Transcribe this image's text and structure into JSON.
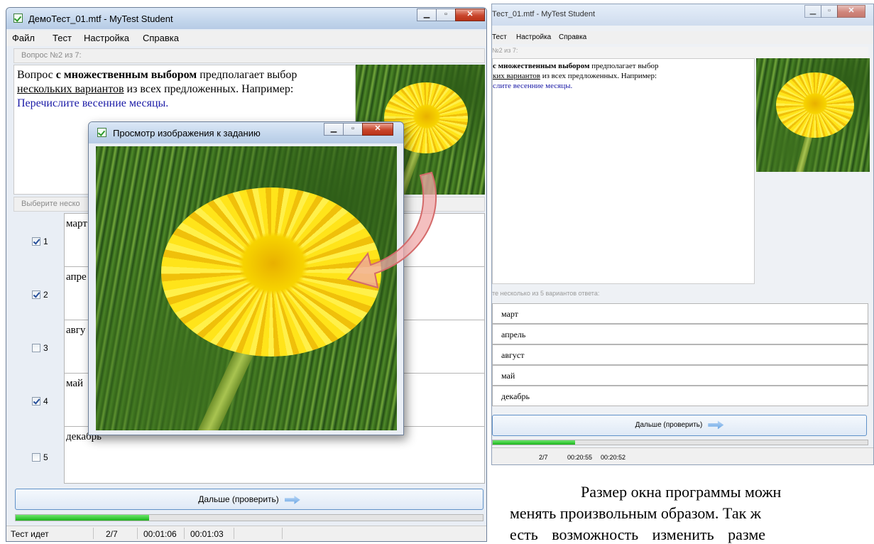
{
  "main_window": {
    "title": "ДемоТест_01.mtf - MyTest Student",
    "menu": [
      "Файл",
      "Тест",
      "Настройка",
      "Справка"
    ],
    "question_header": "Вопрос №2 из 7:",
    "question": {
      "p1": "Вопрос ",
      "bold": "с множественным выбором",
      "p2": " предполагает выбор",
      "underline": "нескольких вариантов",
      "p3": " из всех предложенных. Например:",
      "blue": "Перечислите весенние месяцы."
    },
    "answer_header": "Выберите неско",
    "answers": [
      {
        "num": "1",
        "text": "март",
        "checked": true
      },
      {
        "num": "2",
        "text": "апре",
        "checked": true
      },
      {
        "num": "3",
        "text": "авгу",
        "checked": false
      },
      {
        "num": "4",
        "text": "май",
        "checked": true
      },
      {
        "num": "5",
        "text": "декабрь",
        "checked": false
      }
    ],
    "next_button": "Дальше (проверить)",
    "progress_fraction": 0.285,
    "status": {
      "state": "Тест идет",
      "counter": "2/7",
      "elapsed": "00:01:06",
      "remaining": "00:01:03"
    }
  },
  "image_window": {
    "title": "Просмотр изображения к заданию"
  },
  "right_screenshot": {
    "title": "Тест_01.mtf - MyTest Student",
    "menu": [
      "Тест",
      "Настройка",
      "Справка"
    ],
    "question_header": "№2 из 7:",
    "question": {
      "bold": "с множественным выбором",
      "p1": " предполагает выбор",
      "underline": "ких вариантов",
      "p2": " из всех предложенных. Например:",
      "blue": "слите весенние месяцы."
    },
    "answer_header": "те несколько из 5 вариантов ответа:",
    "answers": [
      "март",
      "апрель",
      "август",
      "май",
      "декабрь"
    ],
    "next_button": "Дальше (проверить)",
    "progress_fraction": 0.22,
    "status": {
      "counter": "2/7",
      "elapsed": "00:20:55",
      "remaining": "00:20:52"
    }
  },
  "caption": {
    "line1": "Размер окна программы можн",
    "line2": "менять произвольным образом. Так ж",
    "line3": "есть возможность изменить разме"
  },
  "colors": {
    "accent_blue": "#1a1aa6",
    "progress_green": "#1cb41c",
    "close_red": "#c9462c"
  }
}
